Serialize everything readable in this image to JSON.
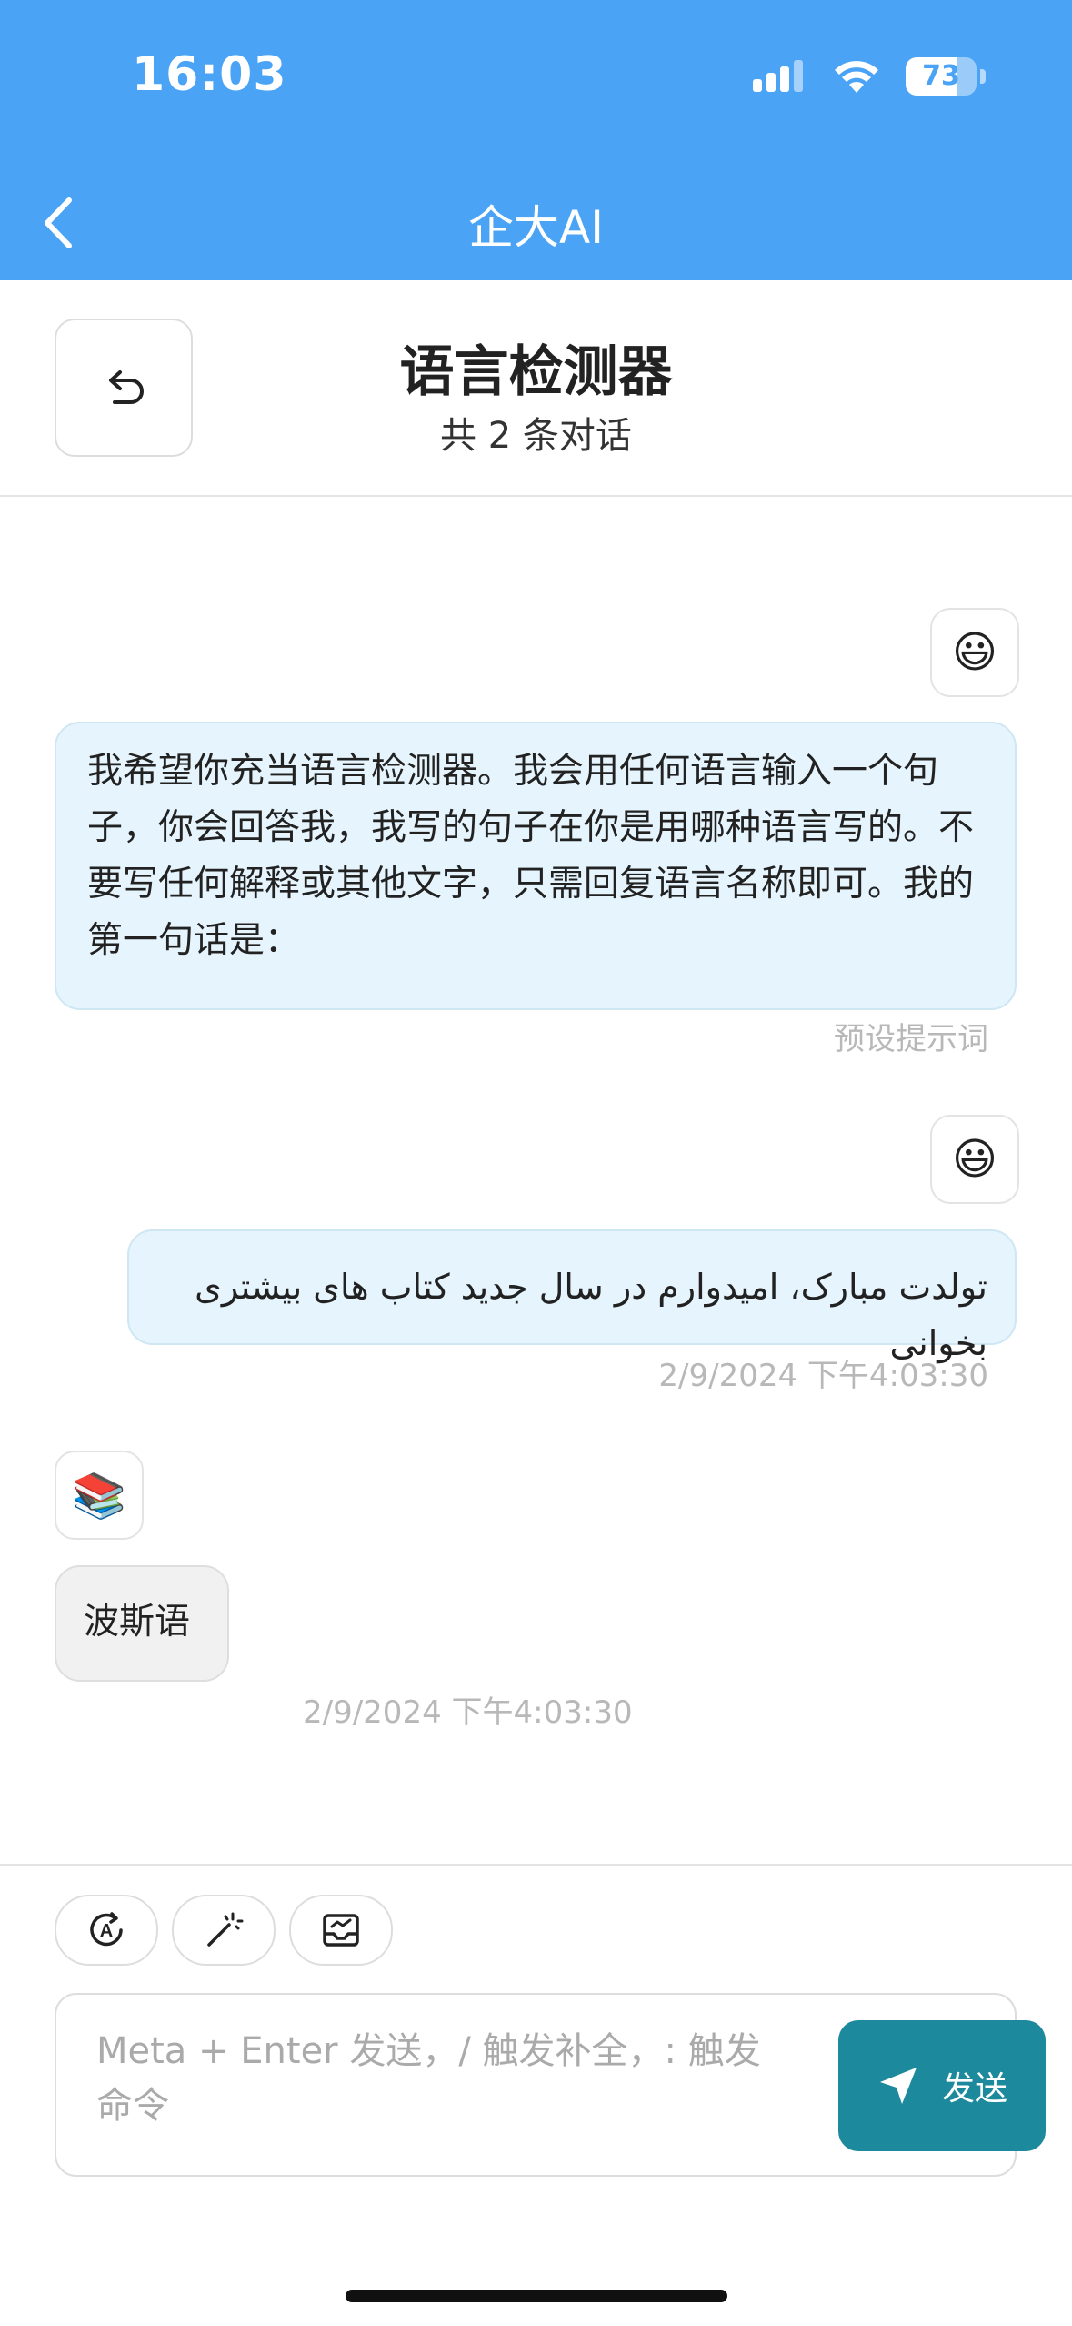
{
  "status_bar": {
    "time": "16:03",
    "battery": "73",
    "battery_level": 0.73
  },
  "header": {
    "title": "企大AI"
  },
  "chat": {
    "title": "语言检测器",
    "subtitle": "共 2 条对话"
  },
  "messages": [
    {
      "role": "user",
      "avatar": "😃",
      "text": "我希望你充当语言检测器。我会用任何语言输入一个句子，你会回答我，我写的句子在你是用哪种语言写的。不要写任何解释或其他文字，只需回复语言名称即可。我的第一句话是：",
      "meta": "预设提示词"
    },
    {
      "role": "user",
      "avatar": "😃",
      "text": "تولدت مبارک، امیدوارم در سال جدید کتاب های بیشتری بخوانی",
      "meta": "2/9/2024 下午4:03:30"
    },
    {
      "role": "bot",
      "avatar": "📚",
      "text": "波斯语",
      "meta": "2/9/2024 下午4:03:30"
    }
  ],
  "composer": {
    "placeholder": "Meta + Enter 发送，/ 触发补全，: 触发命令",
    "send_label": "发送",
    "tools": [
      "auto-language-icon",
      "magic-wand-icon",
      "inbox-icon"
    ]
  },
  "colors": {
    "header": "#4aa3f5",
    "send": "#1c8a9c",
    "user_bubble": "#e6f5fd",
    "bot_bubble": "#f1f1f1"
  }
}
